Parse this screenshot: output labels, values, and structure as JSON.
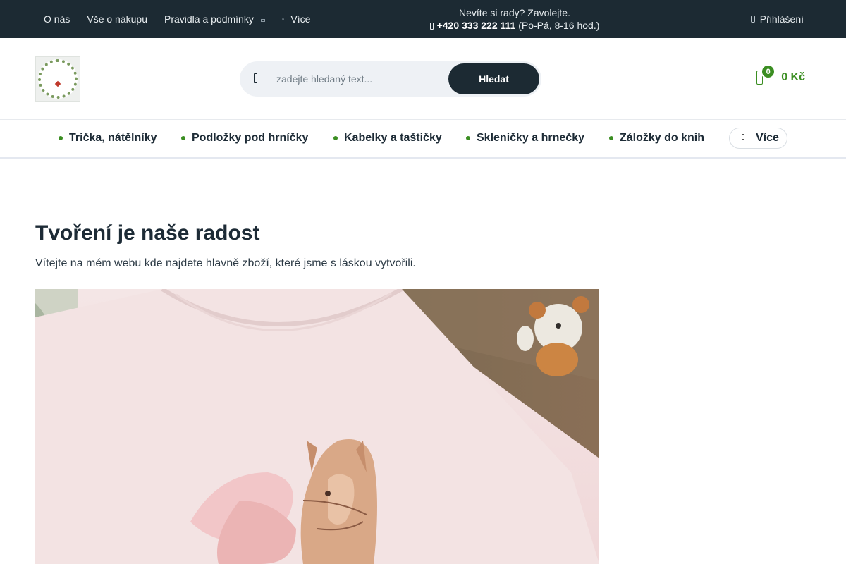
{
  "topbar": {
    "links": [
      {
        "label": "O nás"
      },
      {
        "label": "Vše o nákupu"
      },
      {
        "label": "Pravidla a podmínky"
      },
      {
        "label": "Více"
      }
    ],
    "contact": {
      "line1": "Nevíte si rady? Zavolejte.",
      "phone": "+420 333 222 111",
      "hours": "(Po-Pá, 8-16 hod.)"
    },
    "login_label": "Přihlášení"
  },
  "header": {
    "logo_alt": "Vyrobeno s láskou",
    "search": {
      "placeholder": "zadejte hledaný text...",
      "value": "",
      "button_label": "Hledat"
    },
    "cart": {
      "count": "0",
      "total": "0 Kč"
    }
  },
  "categories": [
    {
      "label": "Trička, nátělníky"
    },
    {
      "label": "Podložky pod hrníčky"
    },
    {
      "label": "Kabelky a taštičky"
    },
    {
      "label": "Skleničky a hrnečky"
    },
    {
      "label": "Záložky do knih"
    }
  ],
  "categories_more_label": "Více",
  "main": {
    "title": "Tvoření je naše radost",
    "subtitle": "Vítejte na mém webu kde najdete hlavně zboží, které jsme s láskou vytvořili."
  },
  "colors": {
    "topbar_bg": "#1c2a33",
    "accent_green": "#3b8e22",
    "button_dark": "#1c2a33"
  }
}
